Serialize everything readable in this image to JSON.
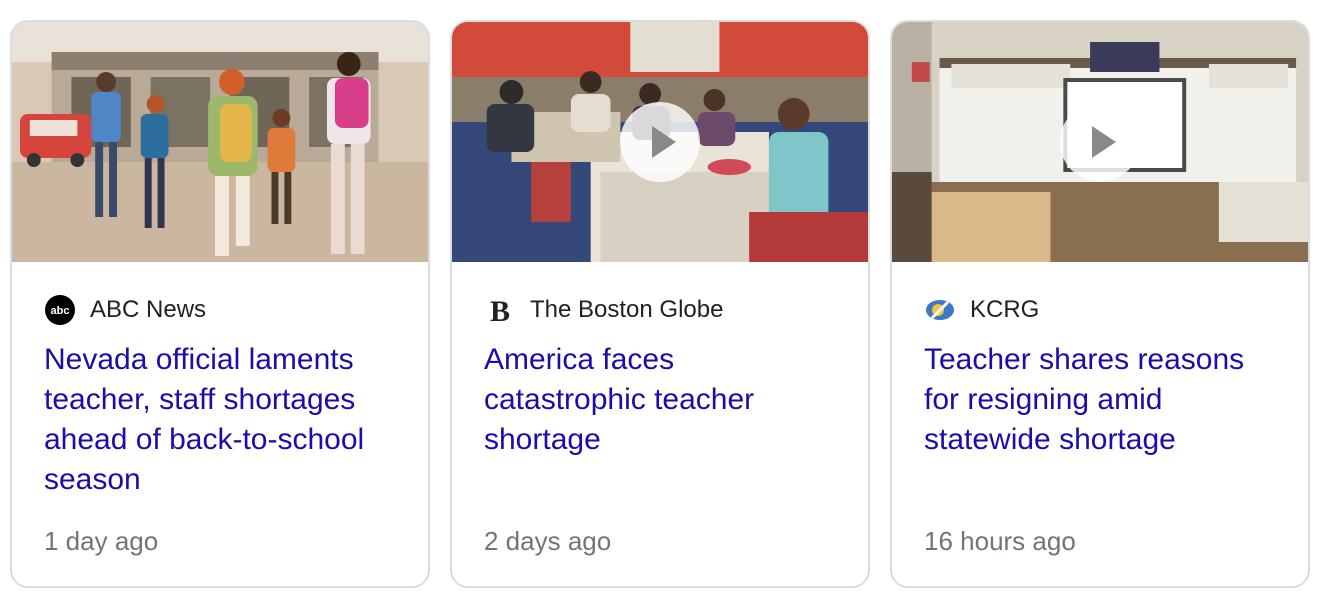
{
  "cards": [
    {
      "source": "ABC News",
      "logo_icon": "abc-news-logo",
      "headline": "Nevada official laments teacher, staff shortages ahead of back-to-school season",
      "time": "1 day ago",
      "has_video": false
    },
    {
      "source": "The Boston Globe",
      "logo_icon": "boston-globe-logo",
      "headline": "America faces catastrophic teacher shortage",
      "time": "2 days ago",
      "has_video": true
    },
    {
      "source": "KCRG",
      "logo_icon": "kcrg-logo",
      "headline": "Teacher shares reasons for resigning amid statewide shortage",
      "time": "16 hours ago",
      "has_video": true
    }
  ],
  "colors": {
    "headline_link": "#1a0dab",
    "source_text": "#202124",
    "timestamp": "#70757a",
    "card_border": "#dadce0"
  }
}
